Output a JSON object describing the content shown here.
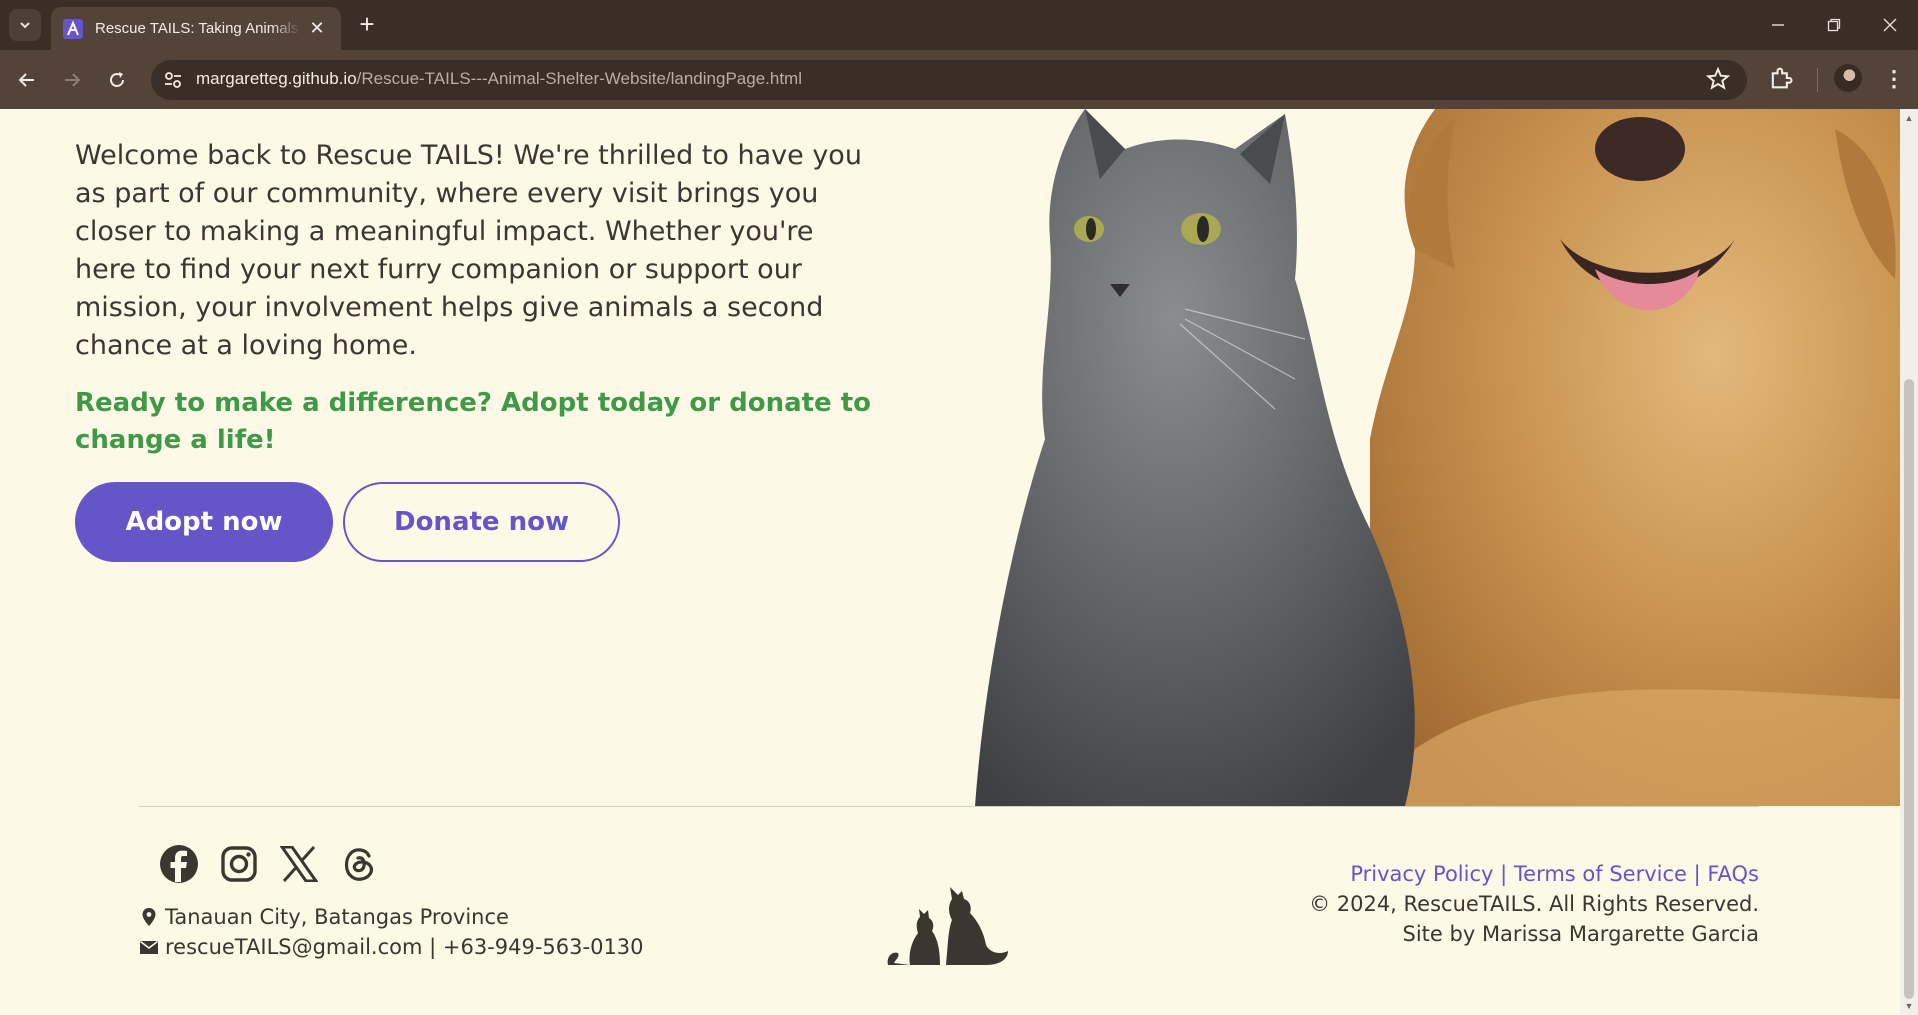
{
  "browser": {
    "tab_title": "Rescue TAILS: Taking Animals In",
    "tab_close": "✕",
    "new_tab": "+",
    "url_domain": "margaretteg.github.io",
    "url_path": "/Rescue-TAILS---Animal-Shelter-Website/landingPage.html",
    "menu": "⋮"
  },
  "hero": {
    "welcome_text": "Welcome back to Rescue TAILS! We're thrilled to have you as part of our community, where every visit brings you closer to making a meaningful impact. Whether you're here to find your next furry companion or support our mission, your involvement helps give animals a second chance at a loving home.",
    "cta_text": "Ready to make a difference? Adopt today or donate to change a life!",
    "adopt_label": "Adopt now",
    "donate_label": "Donate now"
  },
  "footer": {
    "socials": [
      "facebook-icon",
      "instagram-icon",
      "x-icon",
      "threads-icon"
    ],
    "location": "Tanauan City, Batangas Province",
    "contact": "rescueTAILS@gmail.com | +63-949-563-0130",
    "links": {
      "privacy": "Privacy Policy",
      "terms": "Terms of Service",
      "faqs": "FAQs",
      "separator": " | "
    },
    "copyright": "© 2024, RescueTAILS. All Rights Reserved.",
    "credit": "Site by Marissa Margarette Garcia"
  },
  "colors": {
    "accent": "#6654c9",
    "cta_green": "#3f9a48",
    "page_bg": "#fef9e7",
    "text": "#3d3530"
  }
}
